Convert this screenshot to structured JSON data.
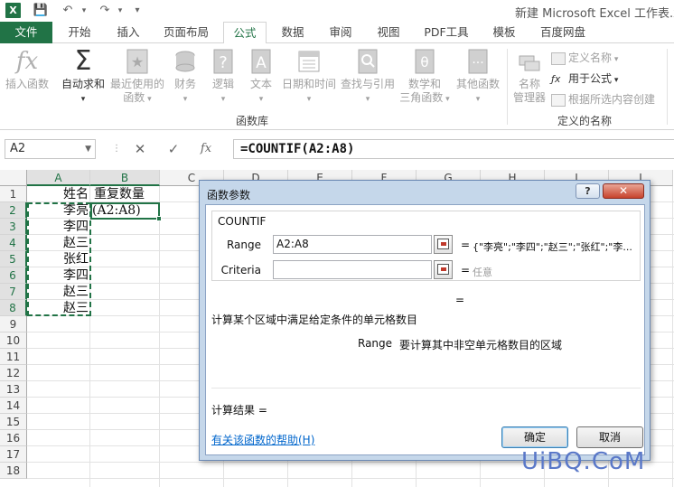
{
  "window": {
    "title": "新建 Microsoft Excel 工作表.xls",
    "app_icon_letter": "X"
  },
  "qat": {
    "save": "💾",
    "undo": "↶",
    "redo": "↷",
    "customize": "▾"
  },
  "tabs": [
    {
      "label": "文件"
    },
    {
      "label": "开始"
    },
    {
      "label": "插入"
    },
    {
      "label": "页面布局"
    },
    {
      "label": "公式"
    },
    {
      "label": "数据"
    },
    {
      "label": "审阅"
    },
    {
      "label": "视图"
    },
    {
      "label": "PDF工具"
    },
    {
      "label": "模板"
    },
    {
      "label": "百度网盘"
    }
  ],
  "ribbon": {
    "insert_function": "插入函数",
    "autosum": "自动求和",
    "recent_1": "最近使用的",
    "recent_2": "函数",
    "finance": "财务",
    "logic": "逻辑",
    "text": "文本",
    "datetime": "日期和时间",
    "lookup": "查找与引用",
    "math_1": "数学和",
    "math_2": "三角函数",
    "other": "其他函数",
    "library_label": "函数库",
    "name_mgr_1": "名称",
    "name_mgr_2": "管理器",
    "define_name": "定义名称",
    "use_in_formula": "用于公式",
    "create_from_sel": "根据所选内容创建",
    "names_label": "定义的名称"
  },
  "formula_bar": {
    "name_box": "A2",
    "cancel": "✕",
    "enter": "✓",
    "fx": "fx",
    "formula": "=COUNTIF(A2:A8)"
  },
  "sheet": {
    "columns": [
      "A",
      "B",
      "C",
      "D",
      "E",
      "F",
      "G",
      "H",
      "I",
      "J"
    ],
    "rows": [
      "1",
      "2",
      "3",
      "4",
      "5",
      "6",
      "7",
      "8",
      "9",
      "10",
      "11",
      "12",
      "13",
      "14",
      "15",
      "16",
      "17",
      "18"
    ],
    "a_values": [
      "姓名",
      "李亮",
      "李四",
      "赵三",
      "张红",
      "李四",
      "赵三",
      "赵三"
    ],
    "b1": "重复数量",
    "b2": "(A2:A8)"
  },
  "dialog": {
    "title": "函数参数",
    "help_btn": "?",
    "close_btn": "✕",
    "function_name": "COUNTIF",
    "range_label": "Range",
    "range_value": "A2:A8",
    "range_preview": "{\"李亮\";\"李四\";\"赵三\";\"张红\";\"李...",
    "criteria_label": "Criteria",
    "criteria_value": "",
    "criteria_preview": "任意",
    "eq": "=",
    "description": "计算某个区域中满足给定条件的单元格数目",
    "arg_name": "Range",
    "arg_description": "要计算其中非空单元格数目的区域",
    "calc_result": "计算结果 =",
    "help_link": "有关该函数的帮助(H)",
    "ok": "确定",
    "cancel": "取消"
  },
  "watermark": "UiBQ.CoM"
}
